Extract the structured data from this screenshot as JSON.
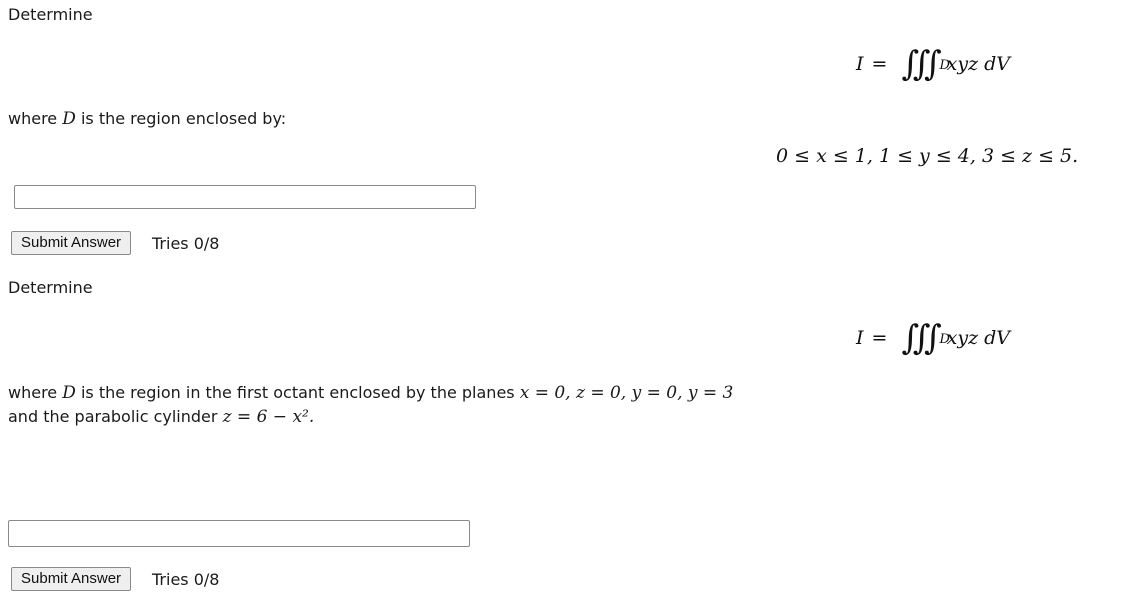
{
  "problem1": {
    "prompt": "Determine",
    "integral": {
      "lhs": "I",
      "equals": "=",
      "symbol": "∭",
      "domain": "D",
      "integrand": "xyz dV"
    },
    "region_intro_prefix": "where",
    "region_symbol": "D",
    "region_intro_suffix": "is the region enclosed by:",
    "bounds": "0 ≤ x ≤ 1,   1 ≤ y ≤ 4,   3 ≤ z ≤ 5.",
    "answer_input": {
      "value": "",
      "placeholder": ""
    },
    "submit_label": "Submit Answer",
    "tries": "Tries 0/8"
  },
  "problem2": {
    "prompt": "Determine",
    "integral": {
      "lhs": "I",
      "equals": "=",
      "symbol": "∭",
      "domain": "D",
      "integrand": "xyz dV"
    },
    "region_line1_prefix": "where",
    "region_symbol": "D",
    "region_line1_text": "is the region in the first octant enclosed by the planes",
    "region_line1_math": "x = 0, z = 0, y = 0, y = 3",
    "region_line2_text": "and the parabolic cylinder",
    "region_line2_math": "z = 6 − x².",
    "answer_input": {
      "value": "",
      "placeholder": ""
    },
    "submit_label": "Submit Answer",
    "tries": "Tries 0/8"
  }
}
